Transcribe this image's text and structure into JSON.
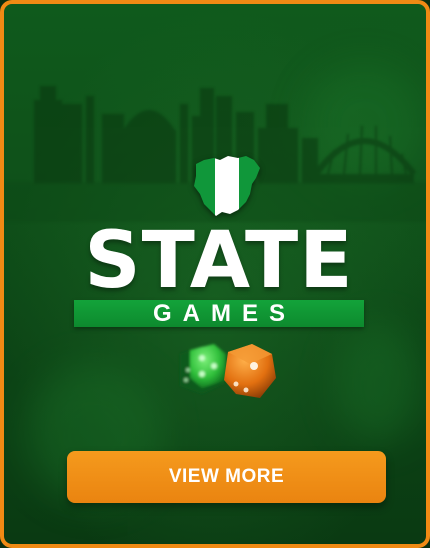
{
  "banner": {
    "title": "STATE",
    "subtitle": "GAMES",
    "button_label": "VIEW MORE"
  },
  "icons": {
    "map": "nigeria-map-flag-icon",
    "dice": "dice-icon",
    "skyline": "city-skyline-graphic"
  },
  "colors": {
    "border": "#f08a14",
    "background": "#0f5a1c",
    "subtitle_bar": "#13a33a",
    "button": "#f59a1d",
    "text": "#ffffff"
  }
}
